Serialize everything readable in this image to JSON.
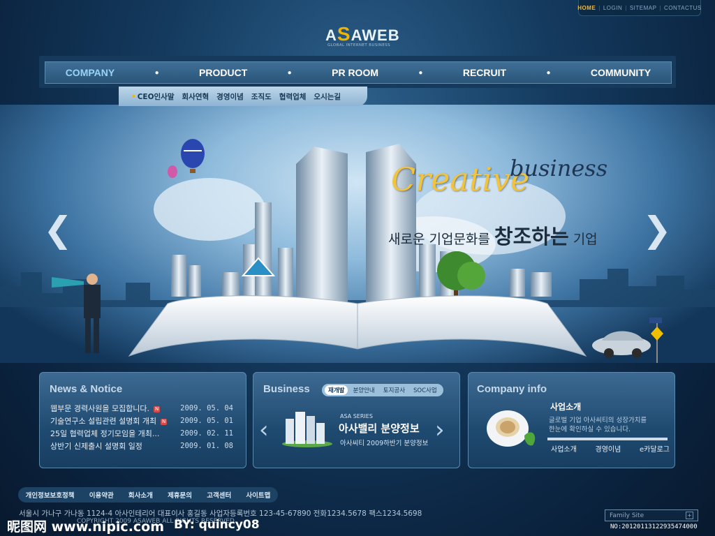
{
  "utility_nav": [
    "HOME",
    "LOGIN",
    "SITEMAP",
    "CONTACTUS"
  ],
  "logo": {
    "prefix": "A",
    "accent": "S",
    "suffix": "AWEB",
    "tagline": "GLOBAL INTERNET BUSINESS"
  },
  "nav": {
    "items": [
      "COMPANY",
      "PRODUCT",
      "PR ROOM",
      "RECRUIT",
      "COMMUNITY"
    ],
    "active": "COMPANY"
  },
  "subnav": [
    "CEO인사말",
    "회사연혁",
    "경영이념",
    "조직도",
    "협력업체",
    "오시는길"
  ],
  "hero": {
    "script_word_1": "Creative",
    "script_word_2": "business",
    "slogan_pre": "새로운 기업문화를 ",
    "slogan_big": "창조하는",
    "slogan_post": " 기업"
  },
  "news": {
    "title": "News & Notice",
    "items": [
      {
        "text": "웹부문 경력사원을 모집합니다.",
        "new": true,
        "date": "2009. 05. 04"
      },
      {
        "text": "기술연구소 설립관련 설명회 개최",
        "new": true,
        "date": "2009. 05. 01"
      },
      {
        "text": "25일 협력업체 정기모임을 개최...",
        "new": false,
        "date": "2009. 02. 11"
      },
      {
        "text": "상반기 신제출시 설명회 일정",
        "new": false,
        "date": "2009. 01. 08"
      }
    ],
    "new_badge": "N"
  },
  "business": {
    "title": "Business",
    "tabs": [
      "재개발",
      "분양안내",
      "토지공사",
      "SOC사업"
    ],
    "series": "ASA SERIES",
    "headline": "아사밸리 분양정보",
    "caption": "아사씨티 2009하반기 분양정보"
  },
  "company_info": {
    "title": "Company info",
    "heading": "사업소개",
    "desc_1": "글로벌 기업 아사씨티의 성장가치를",
    "desc_2": "한눈에 확인하실 수 있습니다.",
    "links": [
      "사업소개",
      "경영이념",
      "e카달로그"
    ]
  },
  "footer": {
    "links": [
      "개인정보보호정책",
      "이용약관",
      "회사소개",
      "제휴문의",
      "고객센터",
      "사이트맵"
    ],
    "address": "서울시 가나구 가나동 1124-4  아사인테리어   대표이사 홍길동   사업자등록번호 123-45-67890  전화1234.5678  팩스1234.5698",
    "copyright": "COPYRIGHT 2009 ASAWEB ALL RIGHTS RESERVED.",
    "family_site": "Family Site"
  },
  "watermark": {
    "site": "昵图网 www.nipic.com",
    "author": "BY: quincy08",
    "id": "NO:20120113122935474000"
  }
}
